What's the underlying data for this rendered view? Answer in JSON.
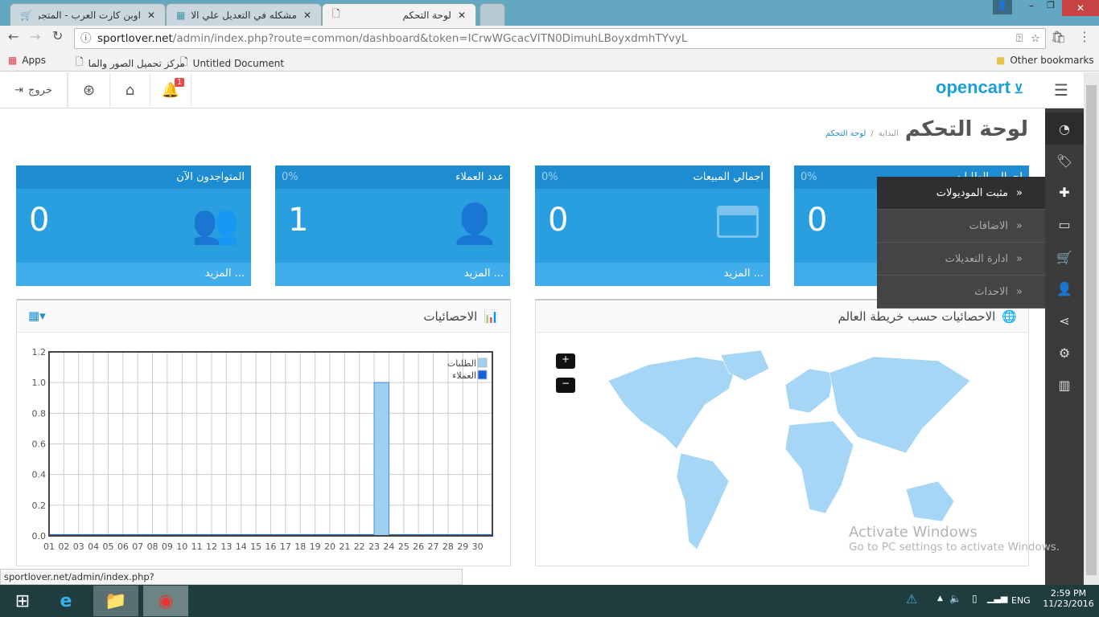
{
  "browser": {
    "tabs": [
      {
        "label": "اوبن كارت العرب - المتجر ا",
        "icon": "cart-icon"
      },
      {
        "label": "مشكله في التعديل علي الا",
        "icon": "calendar-icon"
      },
      {
        "label": "لوحة التحكم",
        "icon": "document-icon",
        "active": true
      }
    ],
    "url_host": "sportlover.net",
    "url_path": "/admin/index.php?route=common/dashboard&token=ICrwWGcacVITN0DimuhLBoyxdmhTYvyL",
    "bookmarks": [
      {
        "label": "Apps"
      },
      {
        "label": "مركز تحميل الصور والما"
      },
      {
        "label": "Untitled Document"
      }
    ],
    "other_bookmarks": "Other bookmarks",
    "status_url": "sportlover.net/admin/index.php?route=extension/installer&token=ICrwWGcacVITN0DimuhLBoyxdmhTYvyL"
  },
  "header": {
    "logo": "opencart",
    "logout": "خروج",
    "notification_count": "1"
  },
  "page": {
    "title": "لوحة التحكم",
    "breadcrumb": [
      "البداية",
      "لوحة التحكم"
    ]
  },
  "tiles": [
    {
      "title": "المتواجدون الآن",
      "percent": "",
      "value": "0",
      "more": "المزيد ...",
      "icon": "users-icon"
    },
    {
      "title": "عدد العملاء",
      "percent": "0%",
      "value": "1",
      "more": "المزيد ...",
      "icon": "user-icon"
    },
    {
      "title": "اجمالي المبيعات",
      "percent": "0%",
      "value": "0",
      "more": "المزيد ...",
      "icon": "credit-card-icon"
    },
    {
      "title": "اجمالي الطلبات",
      "percent": "0%",
      "value": "0",
      "more": "المزيد ...",
      "icon": "cart-icon"
    }
  ],
  "flyout": [
    {
      "label": "مثبت الموديولات",
      "active": true
    },
    {
      "label": "الاضافات"
    },
    {
      "label": "ادارة التعديلات"
    },
    {
      "label": "الاحداث"
    }
  ],
  "map_panel": {
    "title": "الاحصائيات حسب خريطة العالم",
    "zoom_in": "+",
    "zoom_out": "−"
  },
  "chart_panel": {
    "title": "الاحصائيات"
  },
  "chart_data": {
    "type": "bar",
    "x_ticks": [
      "01",
      "02",
      "03",
      "04",
      "05",
      "06",
      "07",
      "08",
      "09",
      "10",
      "11",
      "12",
      "13",
      "14",
      "15",
      "16",
      "17",
      "18",
      "19",
      "20",
      "21",
      "22",
      "23",
      "24",
      "25",
      "26",
      "27",
      "28",
      "29",
      "30"
    ],
    "y_ticks": [
      "0.0",
      "0.2",
      "0.4",
      "0.6",
      "0.8",
      "1.0",
      "1.2"
    ],
    "ylim": [
      0,
      1.2
    ],
    "xlim": [
      1,
      31
    ],
    "grid": true,
    "legend_position": "top-right",
    "series": [
      {
        "name": "الطلبات",
        "color": "#9ccff0",
        "points": [
          {
            "x": 23,
            "y": 1
          }
        ]
      },
      {
        "name": "العملاء",
        "color": "#1065d6",
        "points": []
      }
    ]
  },
  "watermark": {
    "line1": "Activate Windows",
    "line2": "Go to PC settings to activate Windows."
  },
  "taskbar": {
    "time": "2:59 PM",
    "date": "11/23/2016",
    "lang": "ENG"
  },
  "colors": {
    "tile": "#2a9fe0",
    "sidebar": "#3b3b3b",
    "brand": "#1a9fd9"
  }
}
